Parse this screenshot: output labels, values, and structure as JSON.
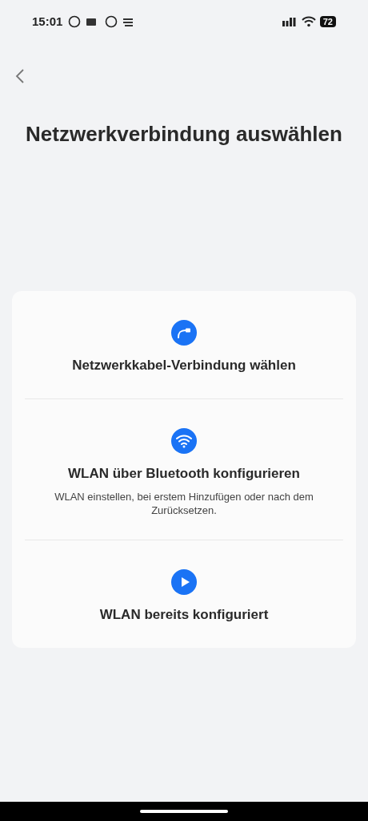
{
  "status_bar": {
    "time": "15:01",
    "battery": "72"
  },
  "title": "Netzwerkverbindung auswählen",
  "options": [
    {
      "kind": "cable",
      "title": "Netzwerkkabel-Verbindung wählen"
    },
    {
      "kind": "wifi",
      "title": "WLAN über Bluetooth konfigurieren",
      "description": "WLAN einstellen, bei erstem Hinzufügen oder nach dem Zurücksetzen."
    },
    {
      "kind": "play",
      "title": "WLAN bereits konfiguriert"
    }
  ]
}
